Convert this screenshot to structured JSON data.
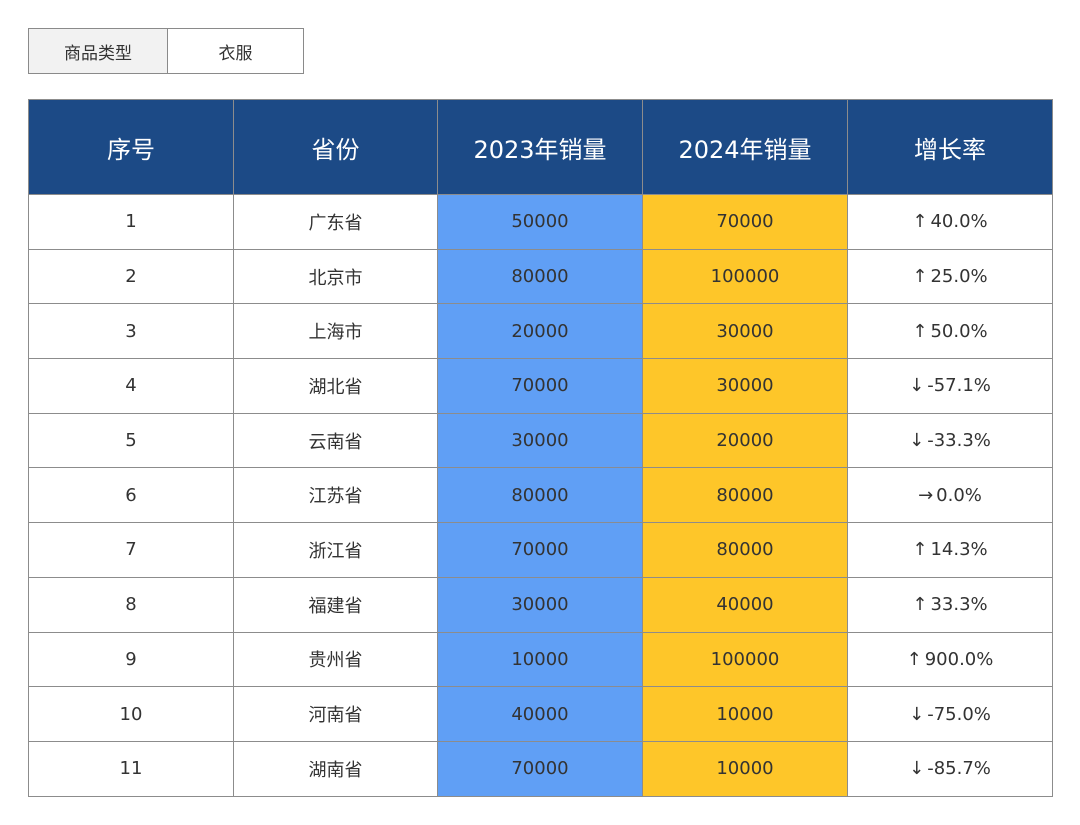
{
  "filter": {
    "label": "商品类型",
    "value": "衣服"
  },
  "table": {
    "headers": [
      "序号",
      "省份",
      "2023年销量",
      "2024年销量",
      "增长率"
    ],
    "colors": {
      "header_bg": "#1c4a86",
      "col_2023_bg": "#609ff5",
      "col_2024_bg": "#fec629",
      "up": "#3a8a1e",
      "down": "#b8333a",
      "flat": "#e2b52a"
    },
    "rows": [
      {
        "idx": "1",
        "province": "广东省",
        "s2023": "50000",
        "s2024": "70000",
        "arrow": "↑",
        "growth": "40.0%",
        "trend": "up"
      },
      {
        "idx": "2",
        "province": "北京市",
        "s2023": "80000",
        "s2024": "100000",
        "arrow": "↑",
        "growth": "25.0%",
        "trend": "up"
      },
      {
        "idx": "3",
        "province": "上海市",
        "s2023": "20000",
        "s2024": "30000",
        "arrow": "↑",
        "growth": "50.0%",
        "trend": "up"
      },
      {
        "idx": "4",
        "province": "湖北省",
        "s2023": "70000",
        "s2024": "30000",
        "arrow": "↓",
        "growth": "-57.1%",
        "trend": "down"
      },
      {
        "idx": "5",
        "province": "云南省",
        "s2023": "30000",
        "s2024": "20000",
        "arrow": "↓",
        "growth": "-33.3%",
        "trend": "down"
      },
      {
        "idx": "6",
        "province": "江苏省",
        "s2023": "80000",
        "s2024": "80000",
        "arrow": "→",
        "growth": "0.0%",
        "trend": "flat"
      },
      {
        "idx": "7",
        "province": "浙江省",
        "s2023": "70000",
        "s2024": "80000",
        "arrow": "↑",
        "growth": "14.3%",
        "trend": "up"
      },
      {
        "idx": "8",
        "province": "福建省",
        "s2023": "30000",
        "s2024": "40000",
        "arrow": "↑",
        "growth": "33.3%",
        "trend": "up"
      },
      {
        "idx": "9",
        "province": "贵州省",
        "s2023": "10000",
        "s2024": "100000",
        "arrow": "↑",
        "growth": "900.0%",
        "trend": "up"
      },
      {
        "idx": "10",
        "province": "河南省",
        "s2023": "40000",
        "s2024": "10000",
        "arrow": "↓",
        "growth": "-75.0%",
        "trend": "down"
      },
      {
        "idx": "11",
        "province": "湖南省",
        "s2023": "70000",
        "s2024": "10000",
        "arrow": "↓",
        "growth": "-85.7%",
        "trend": "down"
      }
    ]
  }
}
